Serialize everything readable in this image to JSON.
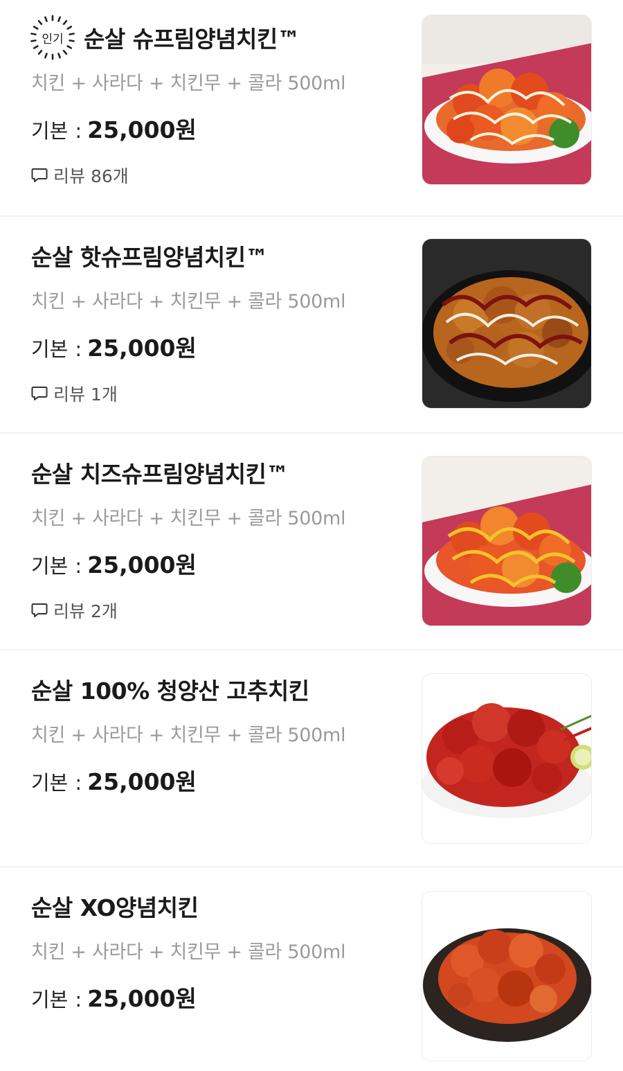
{
  "menu": {
    "items": [
      {
        "name": "순살 슈프림양념치킨™",
        "popular": true,
        "popular_badge": "인기",
        "description": "치킨 + 사라다 + 치킨무 + 콜라 500ml",
        "price_label": "기본",
        "price_separator": ":",
        "price": "25,000원",
        "review": "리뷰 86개",
        "image": "supreme-seasoned-chicken-photo"
      },
      {
        "name": "순살 핫슈프림양념치킨™",
        "description": "치킨 + 사라다 + 치킨무 + 콜라 500ml",
        "price_label": "기본",
        "price_separator": ":",
        "price": "25,000원",
        "review": "리뷰 1개",
        "image": "hot-supreme-seasoned-chicken-photo"
      },
      {
        "name": "순살 치즈슈프림양념치킨™",
        "description": "치킨 + 사라다 + 치킨무 + 콜라 500ml",
        "price_label": "기본",
        "price_separator": ":",
        "price": "25,000원",
        "review": "리뷰 2개",
        "image": "cheese-supreme-seasoned-chicken-photo"
      },
      {
        "name": "순살 100% 청양산 고추치킨",
        "description": "치킨 + 사라다 + 치킨무 + 콜라 500ml",
        "price_label": "기본",
        "price_separator": ":",
        "price": "25,000원",
        "image": "cheongyang-pepper-chicken-photo"
      },
      {
        "name": "순살 XO양념치킨",
        "description": "치킨 + 사라다 + 치킨무 + 콜라 500ml",
        "price_label": "기본",
        "price_separator": ":",
        "price": "25,000원",
        "image": "xo-seasoned-chicken-photo"
      }
    ]
  },
  "colors": {
    "title": "#1a1a1a",
    "description": "#9a9a9a",
    "divider": "#f1f1f1",
    "review": "#555555"
  },
  "icons": {
    "review": "speech-bubble-icon",
    "popular": "sunburst-badge-icon"
  }
}
